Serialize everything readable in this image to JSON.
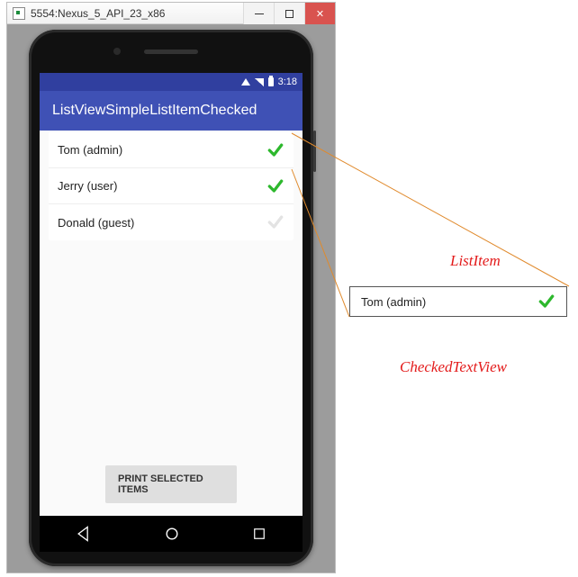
{
  "window": {
    "title": "5554:Nexus_5_API_23_x86"
  },
  "statusbar": {
    "time": "3:18"
  },
  "appbar": {
    "title": "ListViewSimpleListItemChecked"
  },
  "list": {
    "items": [
      {
        "label": "Tom (admin)",
        "checked": true
      },
      {
        "label": "Jerry (user)",
        "checked": true
      },
      {
        "label": "Donald (guest)",
        "checked": false
      }
    ]
  },
  "button": {
    "print": "PRINT SELECTED ITEMS"
  },
  "callout": {
    "label": "Tom (admin)",
    "checked": true
  },
  "annotations": {
    "listitem": "ListItem",
    "checkedtextview": "CheckedTextView"
  }
}
